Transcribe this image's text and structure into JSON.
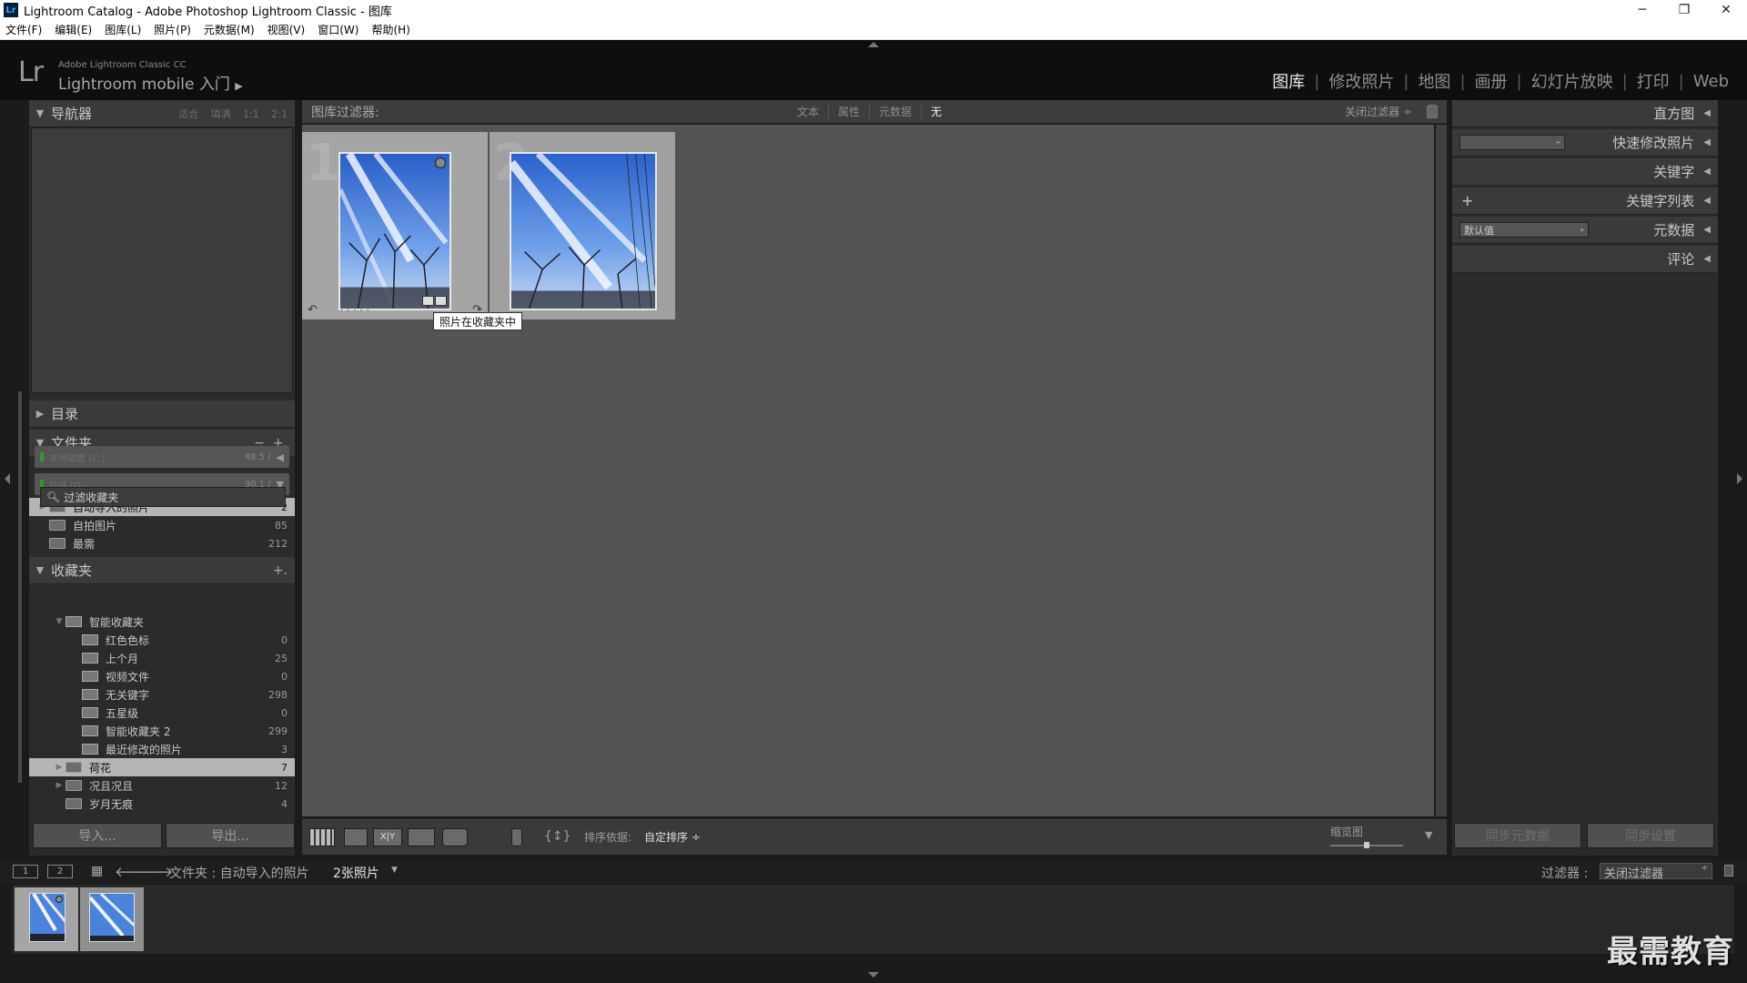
{
  "window": {
    "title": "Lightroom Catalog - Adobe Photoshop Lightroom Classic - 图库",
    "controls": [
      "─",
      "❐",
      "✕"
    ]
  },
  "menu": [
    "文件(F)",
    "编辑(E)",
    "图库(L)",
    "照片(P)",
    "元数据(M)",
    "视图(V)",
    "窗口(W)",
    "帮助(H)"
  ],
  "header": {
    "logo": "Lr",
    "brand": "Adobe Lightroom Classic CC",
    "identity": "Lightroom mobile 入门",
    "identity_arrow": "▶",
    "modules": [
      "图库",
      "修改照片",
      "地图",
      "画册",
      "幻灯片放映",
      "打印",
      "Web"
    ],
    "active_module": "图库"
  },
  "left_panel": {
    "navigator": {
      "title": "导航器",
      "options": "适合  填满  1:1  2:1"
    },
    "catalog": {
      "title": "目录"
    },
    "folders": {
      "title": "文件夹",
      "actions": [
        "−",
        "+."
      ],
      "volumes": [
        {
          "name": "本地磁盘 (C:)",
          "size": "48.5 /",
          "arrow": "◀"
        },
        {
          "name": "软件 (D:)",
          "size": "90.1 /",
          "arrow": "▼"
        }
      ],
      "items": [
        {
          "label": "自动导入的照片",
          "count": "2",
          "selected": true
        },
        {
          "label": "自拍图片",
          "count": "85",
          "selected": false
        },
        {
          "label": "最需",
          "count": "212",
          "selected": false
        }
      ]
    },
    "collections": {
      "title": "收藏夹",
      "add": "+.",
      "search_placeholder": "过滤收藏夹",
      "smart_set": "智能收藏夹",
      "smart_items": [
        {
          "label": "红色色标",
          "count": "0"
        },
        {
          "label": "上个月",
          "count": "25"
        },
        {
          "label": "视频文件",
          "count": "0"
        },
        {
          "label": "无关键字",
          "count": "298"
        },
        {
          "label": "五星级",
          "count": "0"
        },
        {
          "label": "智能收藏夹 2",
          "count": "299"
        },
        {
          "label": "最近修改的照片",
          "count": "3"
        }
      ],
      "sets": [
        {
          "label": "荷花",
          "count": "7",
          "selected": true
        },
        {
          "label": "况且况且",
          "count": "12",
          "selected": false
        },
        {
          "label": "岁月无痕",
          "count": "4",
          "selected": false
        }
      ]
    },
    "import_button": "导入...",
    "export_button": "导出..."
  },
  "filter_bar": {
    "label": "图库过滤器:",
    "tabs": [
      "文本",
      "属性",
      "元数据",
      "无"
    ],
    "active_tab": "无",
    "preset": "关闭过滤器 ÷"
  },
  "grid": {
    "cells": [
      {
        "index": "1",
        "selected": true
      },
      {
        "index": "2",
        "selected": false
      }
    ],
    "tooltip": "照片在收藏夹中"
  },
  "toolbar": {
    "sort_label": "排序依据:",
    "sort_value": "自定排序 ÷",
    "thumb_label": "缩览图",
    "thumb_size": 0.5
  },
  "right_panel": {
    "sections": [
      {
        "title": "直方图"
      },
      {
        "title": "快速修改照片"
      },
      {
        "title": "关键字"
      },
      {
        "title": "关键字列表",
        "prefix": "+"
      },
      {
        "title": "元数据",
        "select": "默认值"
      },
      {
        "title": "评论"
      }
    ],
    "sync_metadata": "同步元数据",
    "sync_settings": "同步设置"
  },
  "filmstrip_bar": {
    "screen1": "1",
    "screen2": "2",
    "source": "文件夹 : 自动导入的照片",
    "count": "2张照片",
    "count_arrow": "▼",
    "filter_label": "过滤器 :",
    "filter_value": "关闭过滤器"
  },
  "watermark": "最需教育"
}
